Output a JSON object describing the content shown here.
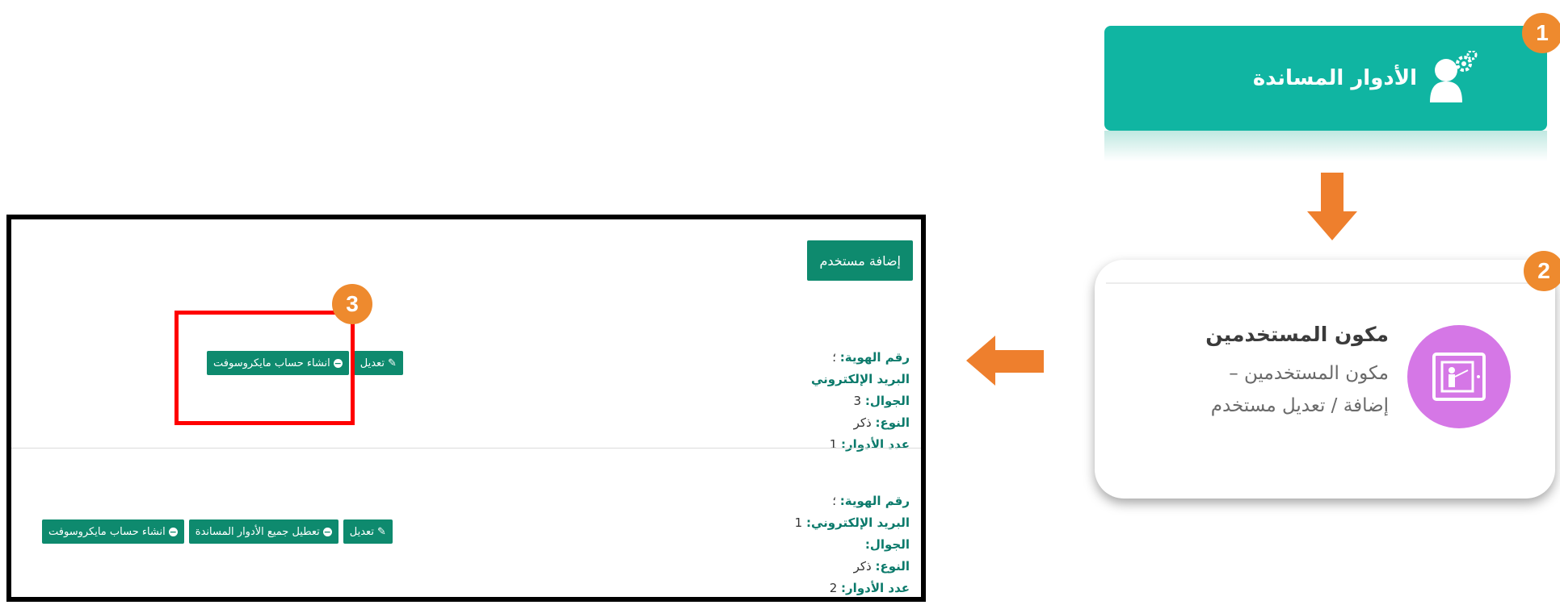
{
  "step1": {
    "badge": "1",
    "title": "الأدوار المساندة"
  },
  "step2": {
    "badge": "2",
    "title": "مكون المستخدمين",
    "desc_line1": "مكون المستخدمين –",
    "desc_line2": "إضافة / تعديل مستخدم"
  },
  "step3": {
    "badge": "3"
  },
  "panel": {
    "add_user_label": "إضافة مستخدم",
    "users": [
      {
        "id_label": "رقم الهوية:",
        "id_value": "؛",
        "email_label": "البريد الإلكتروني",
        "email_value": "",
        "mobile_label": "الجوال:",
        "mobile_value": "3",
        "gender_label": "النوع:",
        "gender_value": "ذكر",
        "roles_label": "عدد الأدوار:",
        "roles_value": "1",
        "actions": [
          {
            "label": "تعديل",
            "icon": "edit-icon"
          },
          {
            "label": "انشاء حساب مايكروسوفت",
            "icon": "minus-circle-icon"
          }
        ]
      },
      {
        "id_label": "رقم الهوية:",
        "id_value": "؛",
        "email_label": "البريد الإلكتروني:",
        "email_value": "1",
        "mobile_label": "الجوال:",
        "mobile_value": "",
        "gender_label": "النوع:",
        "gender_value": "ذكر",
        "roles_label": "عدد الأدوار:",
        "roles_value": "2",
        "actions": [
          {
            "label": "تعديل",
            "icon": "edit-icon"
          },
          {
            "label": "تعطيل جميع الأدوار المساندة",
            "icon": "minus-circle-icon"
          },
          {
            "label": "انشاء حساب مايكروسوفت",
            "icon": "minus-circle-icon"
          }
        ]
      }
    ]
  },
  "colors": {
    "teal": "#10b5a2",
    "badge": "#ee8a2e",
    "button": "#0e8a6e",
    "highlight": "#ff0000",
    "component": "#d577e6"
  }
}
